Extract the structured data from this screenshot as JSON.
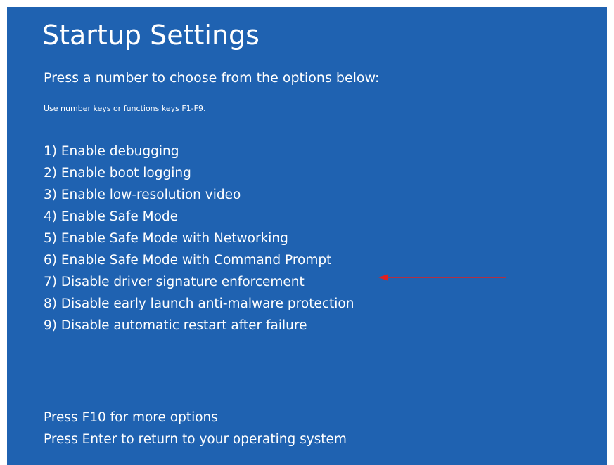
{
  "screen": {
    "title": "Startup Settings",
    "subtitle": "Press a number to choose from the options below:",
    "hint": "Use number keys or functions keys F1-F9.",
    "options": [
      "1) Enable debugging",
      "2) Enable boot logging",
      "3) Enable low-resolution video",
      "4) Enable Safe Mode",
      "5) Enable Safe Mode with Networking",
      "6) Enable Safe Mode with Command Prompt",
      "7) Disable driver signature enforcement",
      "8) Disable early launch anti-malware protection",
      "9) Disable automatic restart after failure"
    ],
    "footer": {
      "more_options": "Press F10 for more options",
      "return": "Press Enter to return to your operating system"
    }
  },
  "colors": {
    "background": "#1f62b1",
    "text": "#ffffff",
    "annotation_arrow": "#e02020"
  },
  "annotation": {
    "icon": "red-arrow-icon",
    "points_to_option": 7
  }
}
